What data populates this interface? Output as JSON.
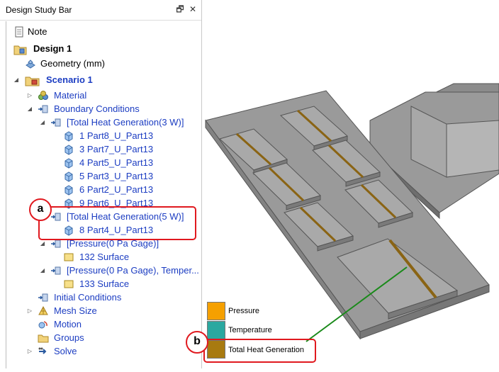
{
  "panel": {
    "title": "Design Study Bar",
    "pin_glyph": "🗗",
    "close_glyph": "✕"
  },
  "tree": {
    "note": "Note",
    "design": "Design 1",
    "geometry": "Geometry (mm)",
    "scenario": "Scenario 1",
    "material": "Material",
    "boundary_conditions": "Boundary Conditions",
    "heat_3w": "[Total Heat Generation(3 W)]",
    "parts_3w": [
      "1 Part8_U_Part13",
      "3 Part7_U_Part13",
      "4 Part5_U_Part13",
      "5 Part3_U_Part13",
      "6 Part2_U_Part13",
      "9 Part6_U_Part13"
    ],
    "heat_5w": "[Total Heat Generation(5 W)]",
    "part_5w": "8 Part4_U_Part13",
    "pressure": "[Pressure(0 Pa Gage)]",
    "surface_132": "132 Surface",
    "pressure_temp": "[Pressure(0 Pa Gage), Temper...",
    "surface_133": "133 Surface",
    "initial_conditions": "Initial Conditions",
    "mesh_size": "Mesh Size",
    "motion": "Motion",
    "groups": "Groups",
    "solve": "Solve"
  },
  "callouts": {
    "a": "a",
    "b": "b"
  },
  "legend": {
    "items": [
      {
        "label": "Pressure",
        "color": "#f5a000"
      },
      {
        "label": "Temperature",
        "color": "#2aa8a0"
      },
      {
        "label": "Total Heat Generation",
        "color": "#a87a10"
      }
    ]
  },
  "colors": {
    "callout": "#e0191f",
    "tree_link": "#1c3dc2",
    "leader_line": "#1a8a1a",
    "heat_strip": "#8a6414"
  }
}
